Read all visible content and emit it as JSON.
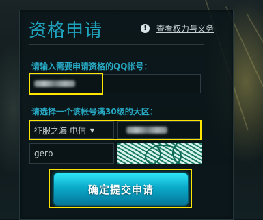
{
  "panel": {
    "title": "资格申请",
    "terms_link": "查看权力与义务",
    "terms_icon": "info-icon"
  },
  "qq_section": {
    "label": "请输入需要申请资格的QQ帐号：",
    "value_obscured": true
  },
  "region_section": {
    "label": "请选择一个该帐号满30级的大区：",
    "region_select": "征服之海 电信",
    "server_obscured": true
  },
  "captcha": {
    "input_value": "gerb"
  },
  "submit_label": "确定提交申请",
  "colors": {
    "accent": "#1fa3bd",
    "highlight": "#ffe500",
    "button": "#0aa9c9"
  }
}
